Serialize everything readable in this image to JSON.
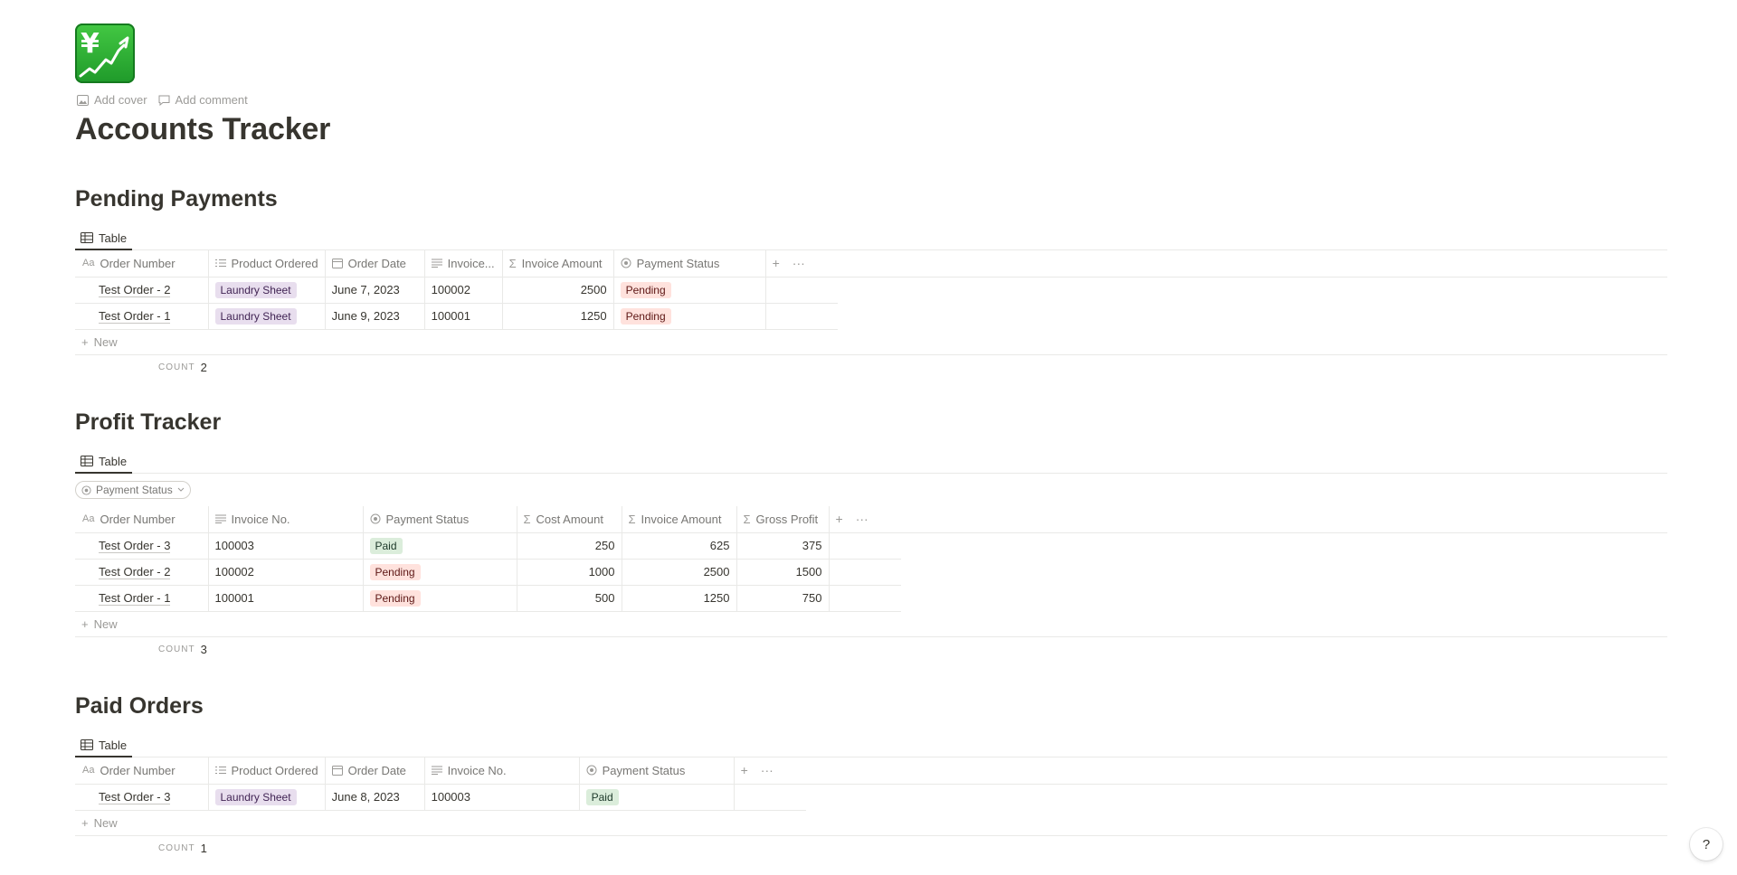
{
  "page": {
    "icon": "yen-chart-icon",
    "actions": {
      "add_cover": "Add cover",
      "add_comment": "Add comment"
    },
    "title": "Accounts Tracker"
  },
  "colors": {
    "purple_tag": "#e8deee",
    "red_tag": "#ffe2dd",
    "green_tag": "#dbeddb",
    "text": "#37352f",
    "muted": "#9b9a97"
  },
  "pending": {
    "title": "Pending Payments",
    "view_tab": "Table",
    "columns": [
      "Order Number",
      "Product Ordered",
      "Order Date",
      "Invoice...",
      "Invoice Amount",
      "Payment Status"
    ],
    "rows": [
      {
        "order": "Test Order - 2",
        "product": "Laundry Sheet",
        "date": "June 7, 2023",
        "invoice": "100002",
        "amount": "2500",
        "status": "Pending"
      },
      {
        "order": "Test Order - 1",
        "product": "Laundry Sheet",
        "date": "June 9, 2023",
        "invoice": "100001",
        "amount": "1250",
        "status": "Pending"
      }
    ],
    "new_label": "New",
    "count_label": "COUNT",
    "count": "2"
  },
  "profit": {
    "title": "Profit Tracker",
    "view_tab": "Table",
    "filter_label": "Payment Status",
    "columns": [
      "Order Number",
      "Invoice No.",
      "Payment Status",
      "Cost Amount",
      "Invoice Amount",
      "Gross Profit"
    ],
    "rows": [
      {
        "order": "Test Order - 3",
        "invoice": "100003",
        "status": "Paid",
        "cost": "250",
        "amount": "625",
        "profit": "375"
      },
      {
        "order": "Test Order - 2",
        "invoice": "100002",
        "status": "Pending",
        "cost": "1000",
        "amount": "2500",
        "profit": "1500"
      },
      {
        "order": "Test Order - 1",
        "invoice": "100001",
        "status": "Pending",
        "cost": "500",
        "amount": "1250",
        "profit": "750"
      }
    ],
    "new_label": "New",
    "count_label": "COUNT",
    "count": "3"
  },
  "paid": {
    "title": "Paid Orders",
    "view_tab": "Table",
    "columns": [
      "Order Number",
      "Product Ordered",
      "Order Date",
      "Invoice No.",
      "Payment Status"
    ],
    "rows": [
      {
        "order": "Test Order - 3",
        "product": "Laundry Sheet",
        "date": "June 8, 2023",
        "invoice": "100003",
        "status": "Paid"
      }
    ],
    "new_label": "New",
    "count_label": "COUNT",
    "count": "1"
  },
  "help": "?"
}
